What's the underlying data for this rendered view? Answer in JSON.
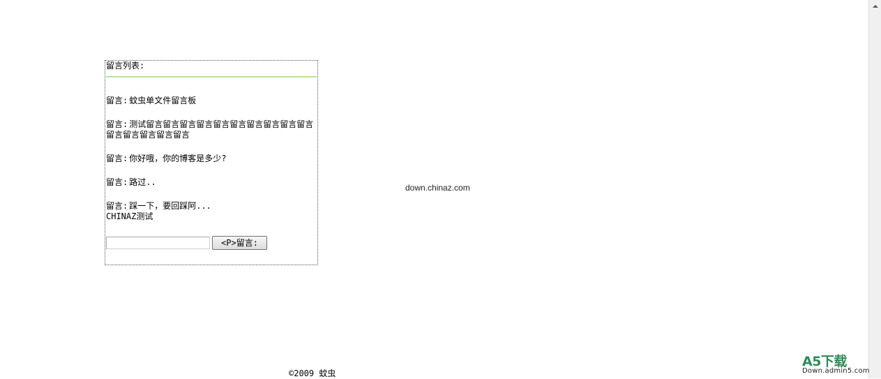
{
  "board": {
    "title": "留言列表:",
    "messages": [
      {
        "prefix": "留言:",
        "text": "蚊虫单文件留言板"
      },
      {
        "prefix": "留言:",
        "text": "测试留言留言留言留言留言留言留言留言留言留言留言留言留言留言留言"
      },
      {
        "prefix": "留言:",
        "text": "你好哦，你的博客是多少?"
      },
      {
        "prefix": "留言:",
        "text": "路过.."
      },
      {
        "prefix": "留言:",
        "text": "踩一下，要回踩阿..."
      }
    ],
    "note": "CHINAZ测试",
    "input_value": "",
    "submit_label": "<P>留言:"
  },
  "site_text": "down.chinaz.com",
  "footer": "©2009 蚊虫",
  "watermark": {
    "brand": "A5下载",
    "domain": "Down.admin5.com"
  }
}
